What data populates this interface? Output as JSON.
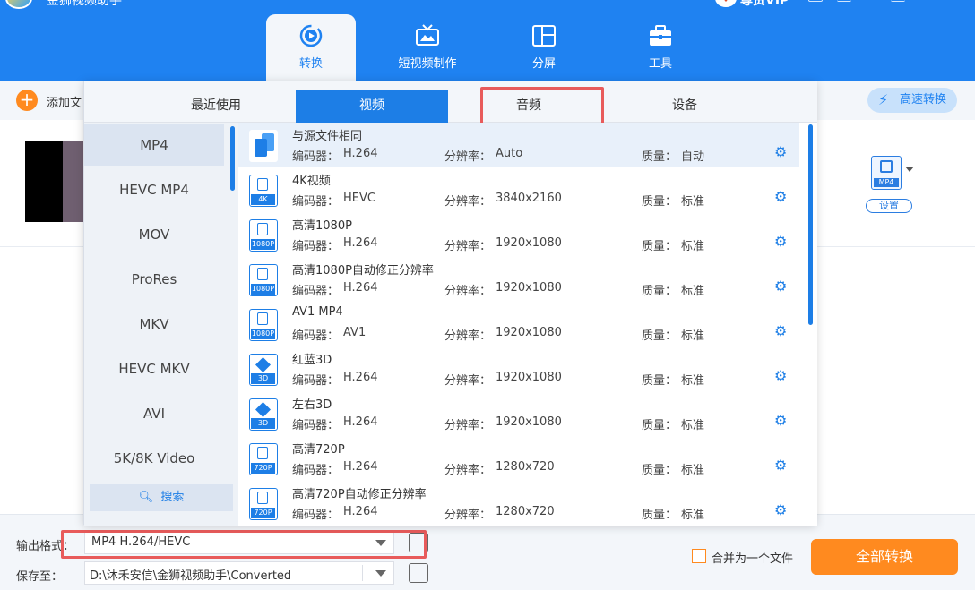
{
  "app": {
    "title": "金狮视频助手"
  },
  "header": {
    "nav": [
      {
        "label": "转换",
        "icon": "convert-icon",
        "active": true
      },
      {
        "label": "短视频制作",
        "icon": "tv-icon",
        "active": false
      },
      {
        "label": "分屏",
        "icon": "split-screen-icon",
        "active": false
      },
      {
        "label": "工具",
        "icon": "toolbox-icon",
        "active": false
      }
    ],
    "vip_label": "尊贵VIP"
  },
  "toolbar": {
    "add_label": "添加文",
    "speed_label": "高速转换"
  },
  "file": {
    "format_tag": "MP4",
    "settings_label": "设置"
  },
  "dropdown": {
    "tabs": [
      {
        "label": "最近使用",
        "active": false
      },
      {
        "label": "视频",
        "active": true
      },
      {
        "label": "音频",
        "active": false
      },
      {
        "label": "设备",
        "active": false
      }
    ],
    "formats": [
      "MP4",
      "HEVC MP4",
      "MOV",
      "ProRes",
      "MKV",
      "HEVC MKV",
      "AVI",
      "5K/8K Video"
    ],
    "search_label": "搜索",
    "meta_labels": {
      "encoder": "编码器：",
      "resolution": "分辨率：",
      "quality": "质量："
    },
    "presets": [
      {
        "name": "与源文件相同",
        "encoder": "H.264",
        "resolution": "Auto",
        "quality": "自动",
        "icon": "same-source-icon",
        "tag": ""
      },
      {
        "name": "4K视频",
        "encoder": "HEVC",
        "resolution": "3840x2160",
        "quality": "标准",
        "icon": "film-icon",
        "tag": "4K"
      },
      {
        "name": "高清1080P",
        "encoder": "H.264",
        "resolution": "1920x1080",
        "quality": "标准",
        "icon": "film-icon",
        "tag": "1080P"
      },
      {
        "name": "高清1080P自动修正分辨率",
        "encoder": "H.264",
        "resolution": "1920x1080",
        "quality": "标准",
        "icon": "film-icon",
        "tag": "1080P"
      },
      {
        "name": "AV1 MP4",
        "encoder": "AV1",
        "resolution": "1920x1080",
        "quality": "标准",
        "icon": "film-icon",
        "tag": "1080P"
      },
      {
        "name": "红蓝3D",
        "encoder": "H.264",
        "resolution": "1920x1080",
        "quality": "标准",
        "icon": "cube-icon",
        "tag": "3D"
      },
      {
        "name": "左右3D",
        "encoder": "H.264",
        "resolution": "1920x1080",
        "quality": "标准",
        "icon": "cube-icon",
        "tag": "3D"
      },
      {
        "name": "高清720P",
        "encoder": "H.264",
        "resolution": "1280x720",
        "quality": "标准",
        "icon": "film-icon",
        "tag": "720P"
      },
      {
        "name": "高清720P自动修正分辨率",
        "encoder": "H.264",
        "resolution": "1280x720",
        "quality": "标准",
        "icon": "film-icon",
        "tag": "720P"
      }
    ]
  },
  "bottom": {
    "output_label": "输出格式：",
    "output_value": "MP4 H.264/HEVC",
    "save_label": "保存至：",
    "save_path": "D:\\沐禾安信\\金狮视频助手\\Converted",
    "merge_label": "合并为一个文件",
    "convert_all_label": "全部转换"
  },
  "colors": {
    "brand_blue": "#1f82f1",
    "accent_orange": "#ff8a1f",
    "highlight_red": "#e85b5b"
  }
}
